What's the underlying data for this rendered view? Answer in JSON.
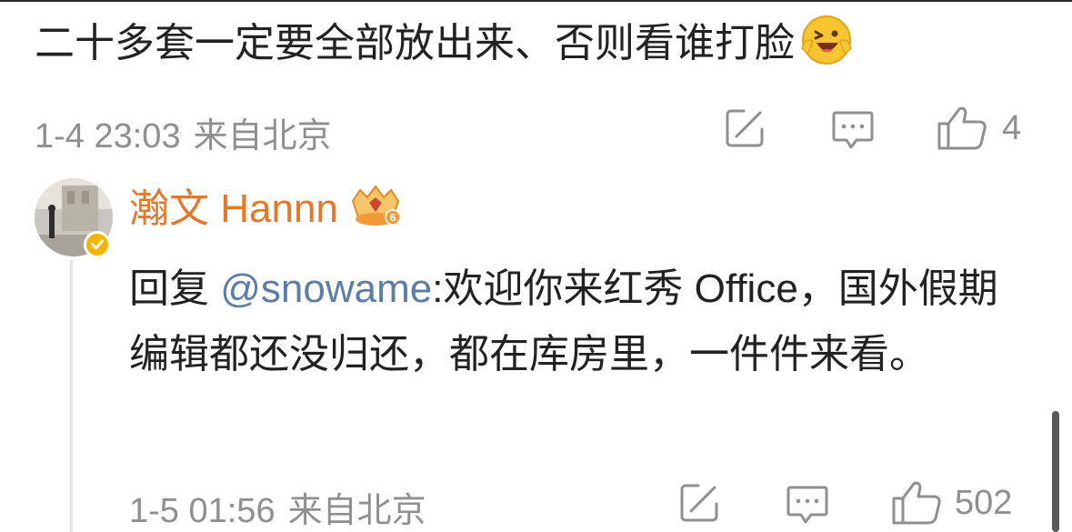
{
  "parent_comment": {
    "text": "二十多套一定要全部放出来、否则看谁打脸",
    "emoji_icon": "laughing-face-emoji-icon",
    "time": "1-4 23:03",
    "location": "来自北京",
    "like_count": "4"
  },
  "reply_comment": {
    "username": "瀚文 Hannn",
    "badge_icon": "vip-crown-badge-icon",
    "reply_prefix": "回复 ",
    "mention": "@snowame",
    "body": ":欢迎你来红秀 Office，国外假期编辑都还没归还，都在库房里，一件件来看。",
    "time": "1-5 01:56",
    "location": "来自北京",
    "like_count": "502"
  },
  "colors": {
    "username": "#e5772b",
    "mention": "#5b7da8",
    "meta_gray": "#8f8f8f",
    "text": "#222222"
  }
}
